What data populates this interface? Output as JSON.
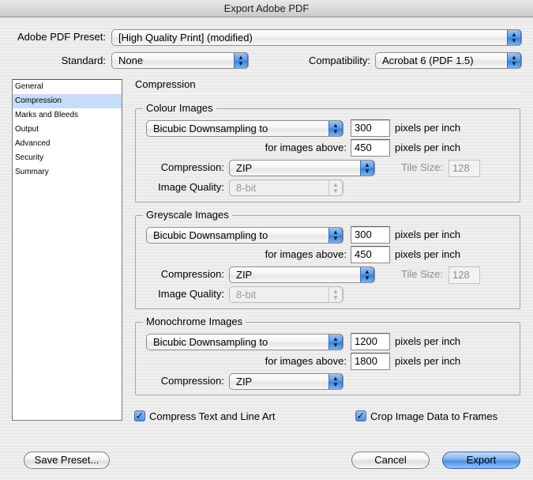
{
  "window": {
    "title": "Export Adobe PDF"
  },
  "preset": {
    "label": "Adobe PDF Preset:",
    "value": "[High Quality Print] (modified)"
  },
  "standard": {
    "label": "Standard:",
    "value": "None"
  },
  "compatibility": {
    "label": "Compatibility:",
    "value": "Acrobat 6 (PDF 1.5)"
  },
  "sidebar": {
    "items": [
      {
        "label": "General"
      },
      {
        "label": "Compression"
      },
      {
        "label": "Marks and Bleeds"
      },
      {
        "label": "Output"
      },
      {
        "label": "Advanced"
      },
      {
        "label": "Security"
      },
      {
        "label": "Summary"
      }
    ],
    "selected": "Compression"
  },
  "section_title": "Compression",
  "colour": {
    "title": "Colour Images",
    "sampling": "Bicubic Downsampling to",
    "ppi": "300",
    "ppi_unit": "pixels per inch",
    "above_label": "for images above:",
    "above": "450",
    "above_unit": "pixels per inch",
    "compression_label": "Compression:",
    "compression": "ZIP",
    "tile_label": "Tile Size:",
    "tile": "128",
    "quality_label": "Image Quality:",
    "quality": "8-bit"
  },
  "grey": {
    "title": "Greyscale Images",
    "sampling": "Bicubic Downsampling to",
    "ppi": "300",
    "ppi_unit": "pixels per inch",
    "above_label": "for images above:",
    "above": "450",
    "above_unit": "pixels per inch",
    "compression_label": "Compression:",
    "compression": "ZIP",
    "tile_label": "Tile Size:",
    "tile": "128",
    "quality_label": "Image Quality:",
    "quality": "8-bit"
  },
  "mono": {
    "title": "Monochrome Images",
    "sampling": "Bicubic Downsampling to",
    "ppi": "1200",
    "ppi_unit": "pixels per inch",
    "above_label": "for images above:",
    "above": "1800",
    "above_unit": "pixels per inch",
    "compression_label": "Compression:",
    "compression": "ZIP"
  },
  "options": {
    "compress_text": {
      "label": "Compress Text and Line Art",
      "checked": true
    },
    "crop_image": {
      "label": "Crop Image Data to Frames",
      "checked": true
    }
  },
  "buttons": {
    "save_preset": "Save Preset...",
    "cancel": "Cancel",
    "export": "Export"
  },
  "glyphs": {
    "check": "✓",
    "updown": "▲▼"
  },
  "colors": {
    "accent": "#4d8ee5",
    "selection": "#c7dcf7"
  }
}
